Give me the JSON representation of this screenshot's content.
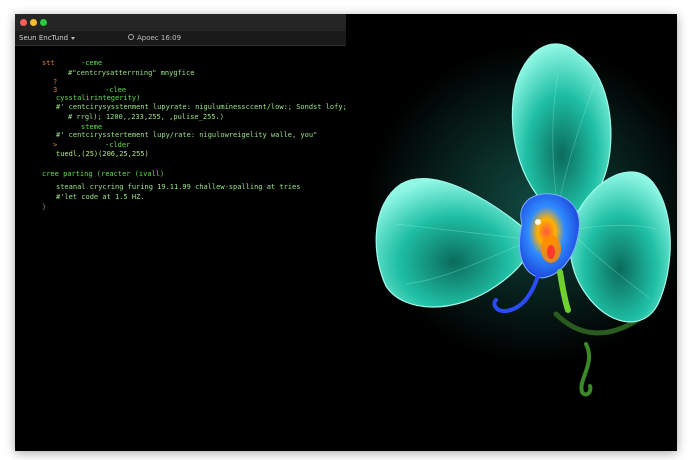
{
  "window": {
    "tabs": [
      {
        "label": "Seun EncTund"
      },
      {
        "label": "Apoec 16:09"
      }
    ]
  },
  "code_lines": [
    {
      "marker": "stt",
      "text": "-ceme"
    },
    {
      "marker": "",
      "text": "#\"centcrysatterrning\" mnygfice"
    },
    {
      "marker": "?",
      "text": ""
    },
    {
      "marker": "3",
      "text": "-clee"
    },
    {
      "marker": "",
      "text": "cysstalirintegerity)"
    },
    {
      "marker": "",
      "text": "#' centcirysysstenment lupyrate: nigulumínessccent/low:; Sondst lofy;"
    },
    {
      "marker": "",
      "text": "# rrgl); 1200,,233,255, ,pulise_255.)"
    },
    {
      "marker": "",
      "text": "steme"
    },
    {
      "marker": "",
      "text": "#' centcirysstertement lupy/rate: nigulowreigelity walle, you\""
    },
    {
      "marker": ">",
      "text": "-clder"
    },
    {
      "marker": "",
      "text": "tuedl,(25)(206,25,255)"
    },
    {
      "marker": "",
      "text": "cree parting (reacter (ivall)"
    },
    {
      "marker": "",
      "text": "steanal crycring furing 19.11.99 challew-spalling at tries"
    },
    {
      "marker": "",
      "text": "#'let code at 1.5 HZ."
    },
    {
      "marker": "",
      "text": "}"
    }
  ],
  "image": {
    "subject": "glowing teal orchid",
    "colors": {
      "background": "#000000",
      "petal": "#2fd3b8",
      "petal_edge": "#8ff7e4",
      "lip": "#1e6cff",
      "center": "#ffb200",
      "stem": "#6fd12f"
    }
  }
}
